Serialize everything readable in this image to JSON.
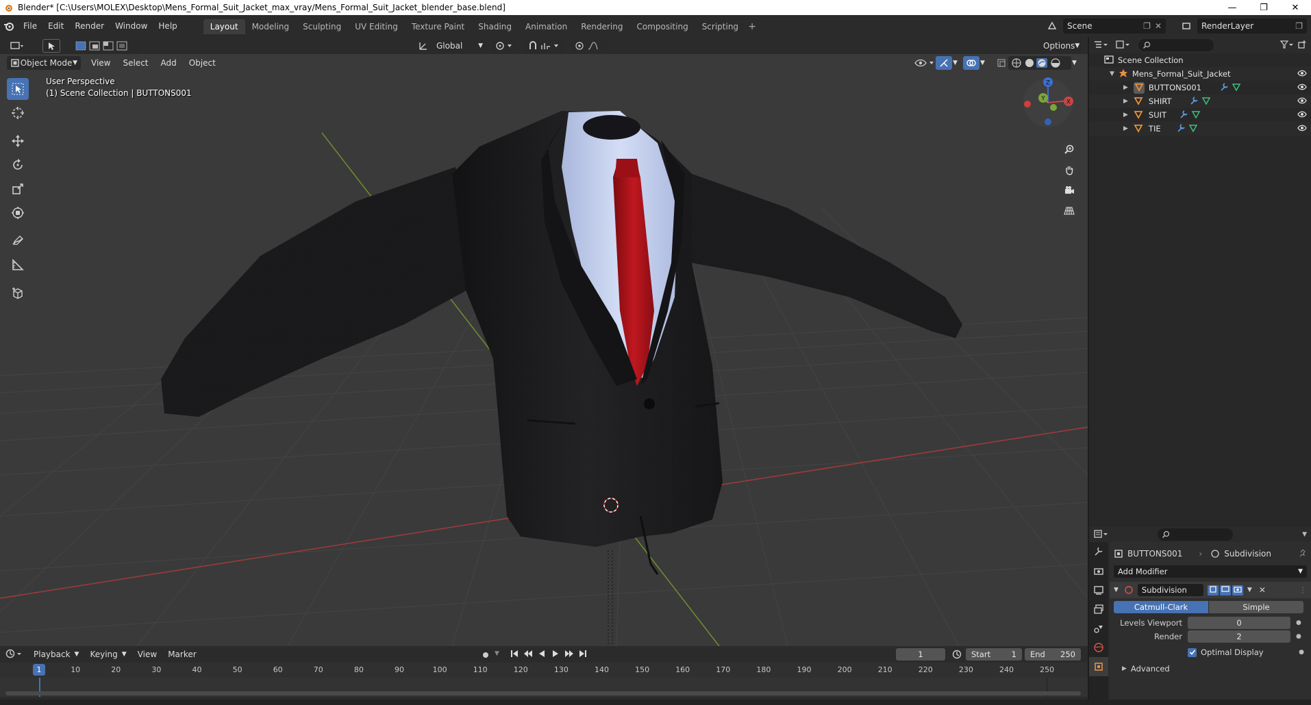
{
  "window": {
    "title": "Blender* [C:\\Users\\MOLEX\\Desktop\\Mens_Formal_Suit_Jacket_max_vray/Mens_Formal_Suit_Jacket_blender_base.blend]"
  },
  "menu": [
    "File",
    "Edit",
    "Render",
    "Window",
    "Help"
  ],
  "workspaces": [
    {
      "label": "Layout",
      "active": true
    },
    {
      "label": "Modeling"
    },
    {
      "label": "Sculpting"
    },
    {
      "label": "UV Editing"
    },
    {
      "label": "Texture Paint"
    },
    {
      "label": "Shading"
    },
    {
      "label": "Animation"
    },
    {
      "label": "Rendering"
    },
    {
      "label": "Compositing"
    },
    {
      "label": "Scripting"
    }
  ],
  "scene": {
    "name": "Scene",
    "render_layer": "RenderLayer"
  },
  "viewport": {
    "transform_orientation": "Global",
    "options_label": "Options",
    "mode": "Object Mode",
    "header_menus": [
      "View",
      "Select",
      "Add",
      "Object"
    ],
    "perspective_label": "User Perspective",
    "collection_label": "(1) Scene Collection | BUTTONS001"
  },
  "gizmo": {
    "z": "Z",
    "y": "Y",
    "x": "X"
  },
  "outliner": {
    "root": "Scene Collection",
    "collection": "Mens_Formal_Suit_Jacket",
    "objects": [
      "BUTTONS001",
      "SHIRT",
      "SUIT",
      "TIE"
    ]
  },
  "properties": {
    "object_name": "BUTTONS001",
    "modifier_tab": "Subdivision",
    "add_modifier": "Add Modifier",
    "modifier_name": "Subdivision",
    "mode_catmull": "Catmull-Clark",
    "mode_simple": "Simple",
    "levels_viewport_label": "Levels Viewport",
    "levels_viewport_value": "0",
    "render_label": "Render",
    "render_value": "2",
    "optimal_display": "Optimal Display",
    "advanced": "Advanced"
  },
  "timeline": {
    "menus": [
      "Playback",
      "Keying",
      "View",
      "Marker"
    ],
    "current_frame": "1",
    "start_label": "Start",
    "start_value": "1",
    "end_label": "End",
    "end_value": "250",
    "ticks": [
      "10",
      "20",
      "30",
      "40",
      "50",
      "60",
      "70",
      "80",
      "90",
      "100",
      "110",
      "120",
      "130",
      "140",
      "150",
      "160",
      "170",
      "180",
      "190",
      "200",
      "210",
      "220",
      "230",
      "240",
      "250"
    ],
    "playhead": "1"
  },
  "colors": {
    "accent": "#4772b3",
    "viewport_bg": "#3a3a3a",
    "x_axis": "#c43c3c",
    "y_axis": "#7ea23a",
    "suit": "#1f1f21",
    "shirt": "#c7d3ef",
    "tie": "#b3121a"
  }
}
